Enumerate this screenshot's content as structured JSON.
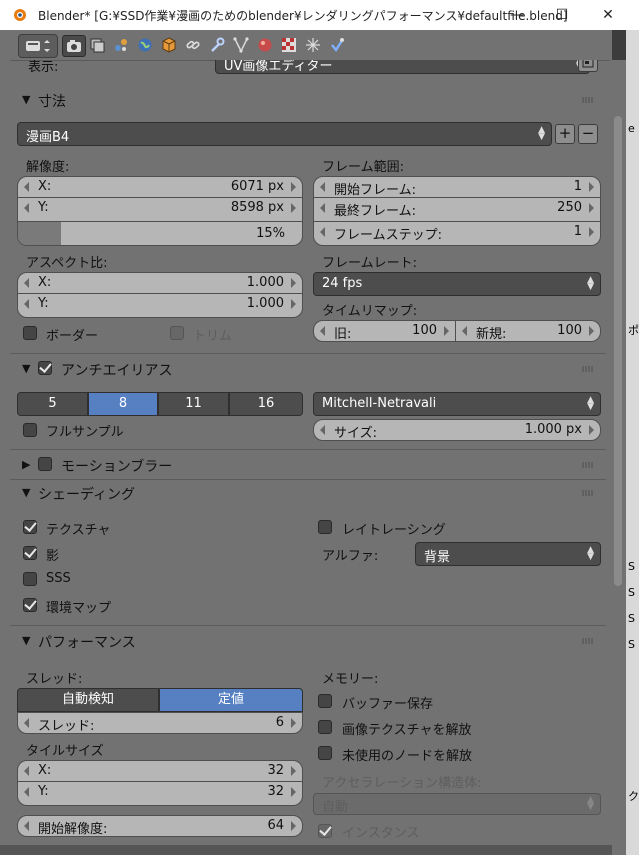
{
  "window": {
    "title": "Blender* [G:¥SSD作業¥漫画のためのblender¥レンダリングパフォーマンス¥defaultfile.blend]",
    "minimize": "—",
    "maximize": "☐",
    "close": "✕"
  },
  "toolbar": {
    "icons": [
      "editor-type-icon",
      "render-tab-icon",
      "render-layers-icon",
      "scene-icon",
      "world-icon",
      "object-icon",
      "constraints-icon",
      "modifiers-icon",
      "data-icon",
      "material-icon",
      "texture-icon",
      "particles-icon",
      "physics-icon"
    ]
  },
  "display": {
    "label": "表示:",
    "value": "UV画像エディター"
  },
  "dimensions": {
    "header": "寸法",
    "preset": "漫画B4",
    "resolution_label": "解像度:",
    "res_x_label": "X:",
    "res_x_value": "6071 px",
    "res_y_label": "Y:",
    "res_y_value": "8598 px",
    "res_percent": "15%",
    "res_percent_fraction": 0.15,
    "frame_range_label": "フレーム範囲:",
    "start_label": "開始フレーム:",
    "start_value": "1",
    "end_label": "最終フレーム:",
    "end_value": "250",
    "step_label": "フレームステップ:",
    "step_value": "1",
    "aspect_label": "アスペクト比:",
    "aspect_x_label": "X:",
    "aspect_x_value": "1.000",
    "aspect_y_label": "Y:",
    "aspect_y_value": "1.000",
    "framerate_label": "フレームレート:",
    "framerate_value": "24 fps",
    "timeremap_label": "タイムリマップ:",
    "old_label": "旧:",
    "old_value": "100",
    "new_label": "新規:",
    "new_value": "100",
    "border_label": "ボーダー",
    "crop_label": "トリム"
  },
  "antialias": {
    "header": "アンチエイリアス",
    "samples": [
      "5",
      "8",
      "11",
      "16"
    ],
    "selected": "8",
    "filter": "Mitchell-Netravali",
    "full_sample_label": "フルサンプル",
    "size_label": "サイズ:",
    "size_value": "1.000 px"
  },
  "motion_blur": {
    "header": "モーションブラー"
  },
  "shading": {
    "header": "シェーディング",
    "textures_label": "テクスチャ",
    "shadows_label": "影",
    "sss_label": "SSS",
    "envmap_label": "環境マップ",
    "raytrace_label": "レイトレーシング",
    "alpha_label": "アルファ:",
    "alpha_value": "背景"
  },
  "performance": {
    "header": "パフォーマンス",
    "threads_label": "スレッド:",
    "auto_detect": "自動検知",
    "fixed": "定値",
    "threads_field_label": "スレッド:",
    "threads_value": "6",
    "tile_size_label": "タイルサイズ",
    "tile_x_label": "X:",
    "tile_x_value": "32",
    "tile_y_label": "Y:",
    "tile_y_value": "32",
    "start_res_label": "開始解像度:",
    "start_res_value": "64",
    "memory_label": "メモリー:",
    "save_buffers_label": "バッファー保存",
    "free_image_label": "画像テクスチャを解放",
    "free_unused_label": "未使用のノードを解放",
    "accel_label": "アクセラレーション構造体:",
    "accel_value": "自動",
    "instances_label": "インスタンス"
  },
  "side_glyphs": [
    "e",
    "ポ",
    "S",
    "S",
    "S",
    "S",
    "ク"
  ]
}
